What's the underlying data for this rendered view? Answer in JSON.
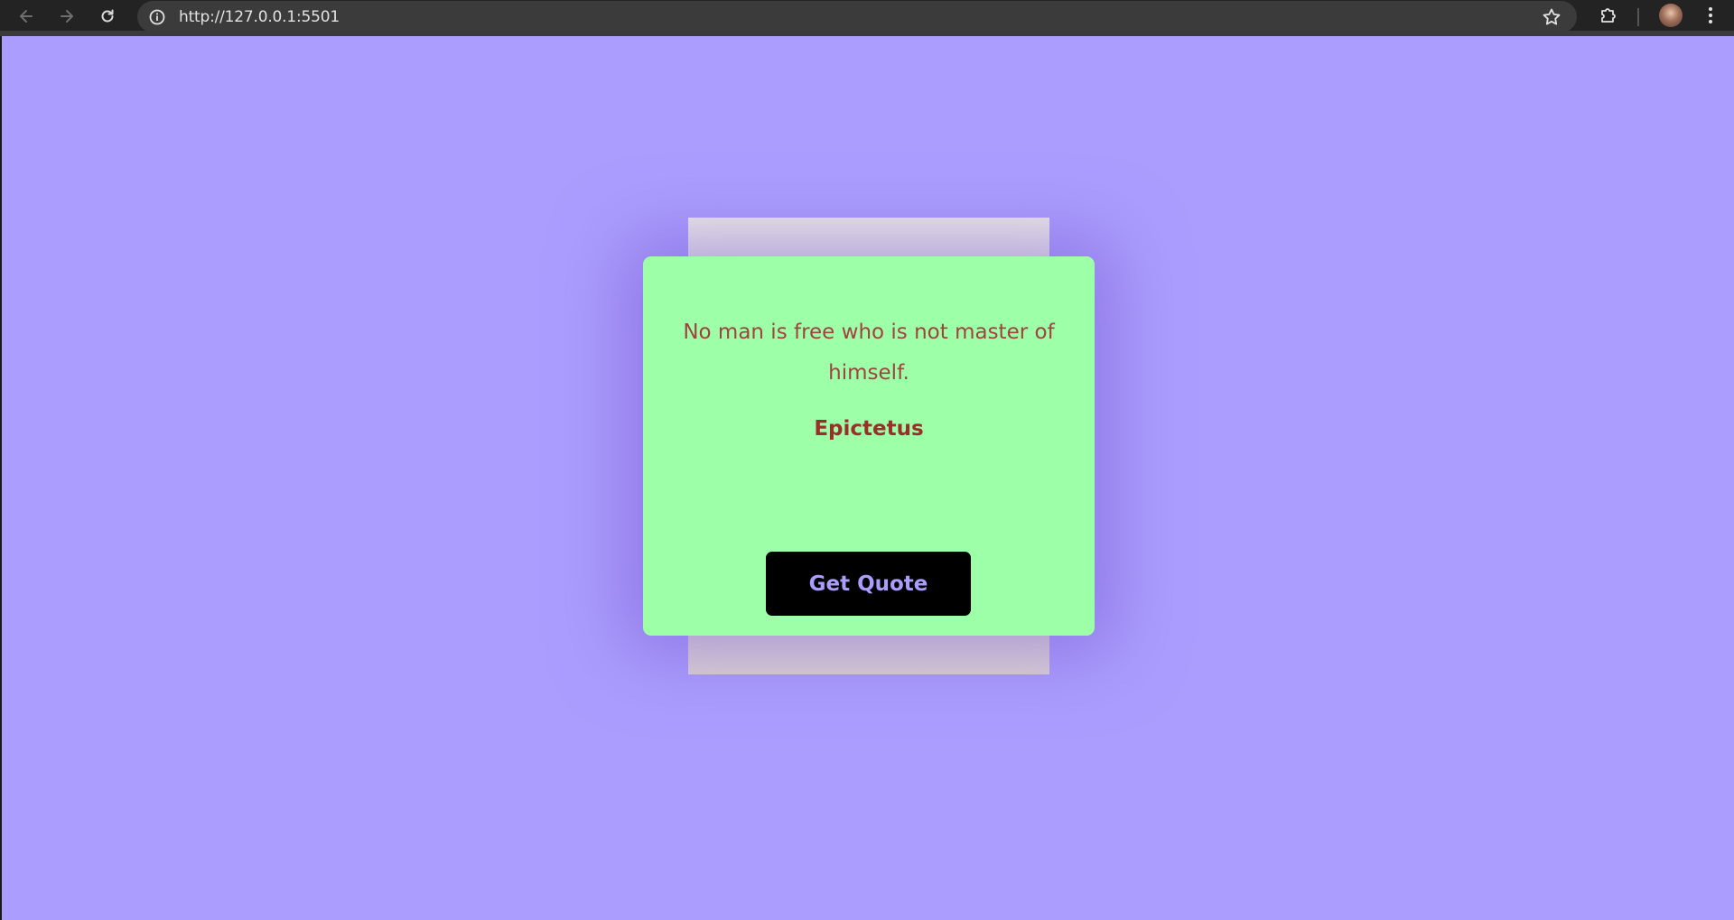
{
  "browser": {
    "url": "http://127.0.0.1:5501",
    "icons": {
      "back": "arrow-left-icon",
      "forward": "arrow-right-icon",
      "reload": "reload-icon",
      "site_info": "info-icon",
      "bookmark": "star-icon",
      "extensions": "puzzle-icon",
      "profile": "avatar",
      "menu": "kebab-menu-icon"
    }
  },
  "quote_card": {
    "text": "No man is free who is not master of himself.",
    "author": "Epictetus",
    "button_label": "Get Quote"
  },
  "colors": {
    "page_background": "#ab9dfe",
    "card_background": "#9effa9",
    "quote_text": "#a0433f",
    "author_text": "#9a2e28",
    "button_background": "#000000",
    "button_text": "#ab9dfe"
  }
}
